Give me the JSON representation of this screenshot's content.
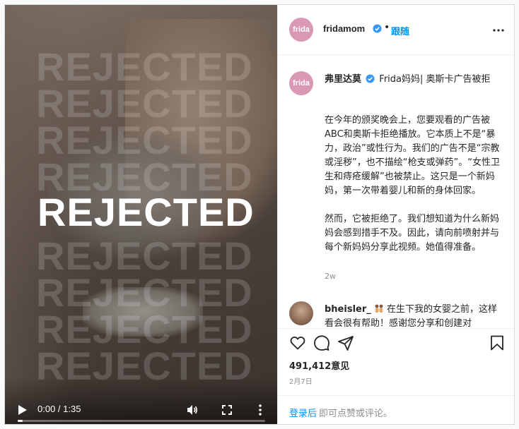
{
  "video": {
    "watermark_text": "REJECTED",
    "headline": "REJECTED",
    "time": "0:00 / 1:35",
    "progress_fraction": 0.02
  },
  "post": {
    "avatar_text": "frida",
    "username": "fridamom",
    "separator": "•",
    "follow_label": "跟随"
  },
  "caption": {
    "avatar_text": "frida",
    "author": "弗里达莫",
    "title_text": "Frida妈妈| 奥斯卡广告被拒",
    "body": "在今年的颁奖晚会上，您要观看的广告被ABC和奥斯卡拒绝播放。它本质上不是“暴力，政治”或性行为。我们的广告不是“宗教或淫秽”，也不描绘“枪支或弹药”。“女性卫生和痔疮缓解”也被禁止。这只是一个新妈妈，第一次带着婴儿和新的身体回家。\n\n然而，它被拒绝了。我们想知道为什么新妈妈会感到措手不及。因此，请向前喷射并与每个新妈妈分享此视频。她值得准备。",
    "age": "2w"
  },
  "comment": {
    "user": "bheisler_",
    "text": "在生下我的女婴之前，这样看会很有帮助！感谢您分享和创建对"
  },
  "stats": {
    "likes": "491,412意见",
    "date": "2月7日"
  },
  "login": {
    "link": "登录后",
    "rest": "即可点赞或评论。"
  },
  "colors": {
    "accent": "#0095f6",
    "verified": "#3897f0",
    "avatar_bg": "#d999b4"
  },
  "icons": [
    "play-icon",
    "volume-icon",
    "fullscreen-icon",
    "more-vertical-icon",
    "verified-icon",
    "more-horizontal-icon",
    "heart-icon",
    "comment-icon",
    "share-icon",
    "bookmark-icon"
  ]
}
